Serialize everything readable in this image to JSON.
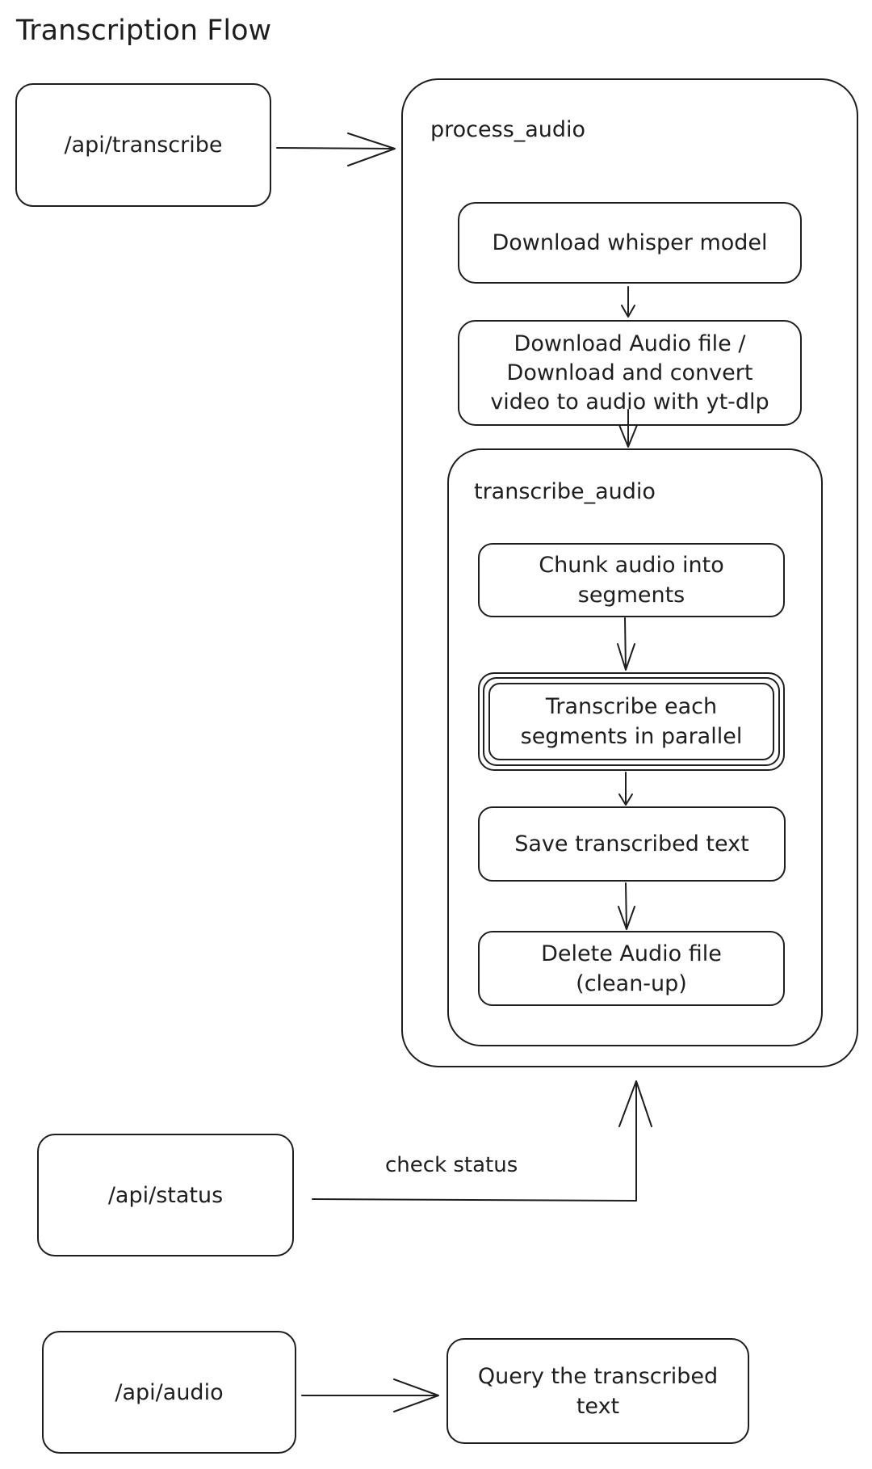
{
  "title": "Transcription Flow",
  "endpoints": {
    "transcribe": "/api/transcribe",
    "status": "/api/status",
    "audio": "/api/audio"
  },
  "process_audio": {
    "label": "process_audio",
    "steps": {
      "download_model": "Download whisper model",
      "download_audio": "Download Audio file /\nDownload and convert\nvideo to audio with yt-dlp"
    },
    "transcribe_audio": {
      "label": "transcribe_audio",
      "steps": {
        "chunk": "Chunk audio into\nsegments",
        "transcribe_parallel": "Transcribe each\nsegments in parallel",
        "save": "Save transcribed text",
        "delete": "Delete Audio file\n(clean-up)"
      }
    }
  },
  "edges": {
    "check_status": "check status"
  },
  "query": "Query the transcribed\ntext"
}
